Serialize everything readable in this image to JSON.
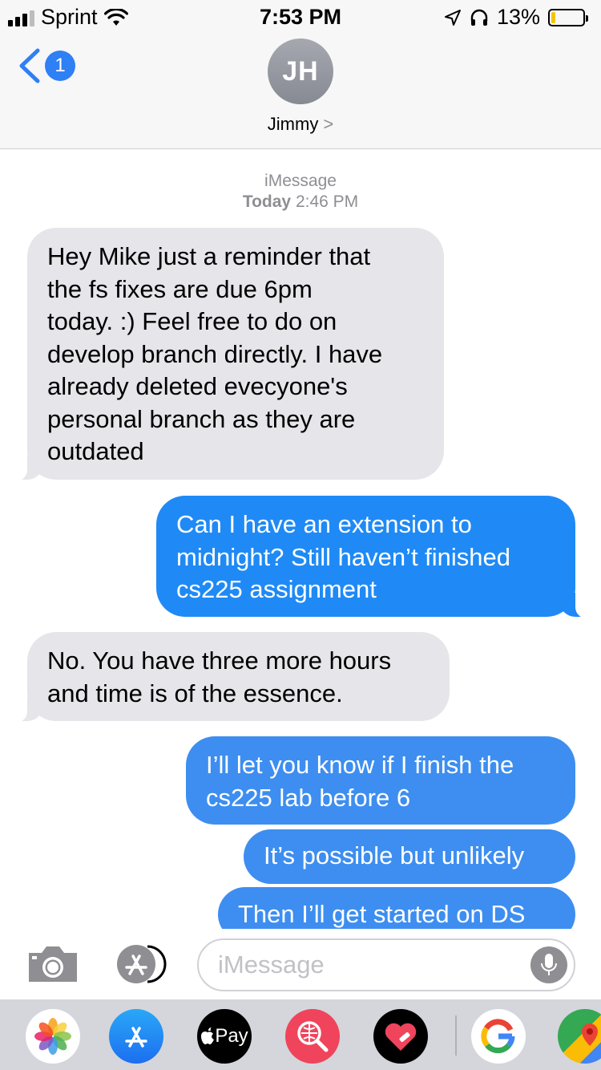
{
  "status_bar": {
    "carrier": "Sprint",
    "time": "7:53 PM",
    "battery_percent": "13%",
    "battery_level": 0.13,
    "icons": [
      "signal-icon",
      "wifi-icon",
      "location-icon",
      "headphones-icon",
      "battery-icon"
    ]
  },
  "header": {
    "back_badge_count": "1",
    "avatar_initials": "JH",
    "contact_name": "Jimmy",
    "contact_chevron": ">"
  },
  "conversation": {
    "service": "iMessage",
    "date_label": "Today",
    "time_label": "2:46 PM",
    "messages": [
      {
        "direction": "incoming",
        "text": "Hey Mike just a reminder that\nthe fs fixes are due 6pm\ntoday. :) Feel free to do on\ndevelop branch directly. I have\nalready deleted evecyone's\npersonal branch as they are\noutdated"
      },
      {
        "direction": "outgoing",
        "text": "Can I have an extension to\nmidnight? Still haven’t finished\ncs225 assignment"
      },
      {
        "direction": "incoming",
        "text": "No. You have three more hours\nand time is of the essence."
      },
      {
        "direction": "outgoing",
        "text": "I’ll let you know if I finish the\ncs225 lab before 6"
      },
      {
        "direction": "outgoing",
        "text": "It’s possible but unlikely"
      },
      {
        "direction": "outgoing",
        "text": "Then I’ll get started on DS"
      }
    ]
  },
  "input_bar": {
    "placeholder": "iMessage",
    "icons": [
      "camera-icon",
      "app-store-icon",
      "microphone-icon"
    ]
  },
  "app_drawer": {
    "apps": [
      {
        "name": "Photos",
        "icon": "photos-icon"
      },
      {
        "name": "App Store",
        "icon": "app-store-icon"
      },
      {
        "name": "Pay",
        "icon": "apple-pay-icon"
      },
      {
        "name": "Search Images",
        "icon": "image-search-icon"
      },
      {
        "name": "Digital Touch",
        "icon": "digital-touch-icon"
      },
      {
        "name": "Google",
        "icon": "google-icon"
      },
      {
        "name": "Maps",
        "icon": "google-maps-icon"
      }
    ],
    "pay_label": "Pay"
  },
  "colors": {
    "incoming_bubble": "#e5e5ea",
    "outgoing_bubble": "#1f8af5",
    "accent": "#2f7ff5",
    "header_bg": "#f7f7f7",
    "drawer_bg": "#d4d6dc"
  }
}
